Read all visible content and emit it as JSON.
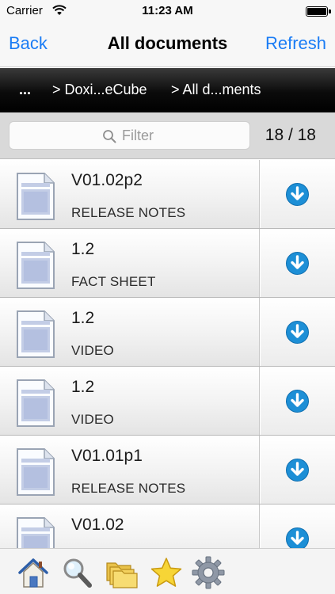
{
  "status_bar": {
    "carrier": "Carrier",
    "time": "11:23 AM",
    "icons": [
      "wifi-icon",
      "battery-icon"
    ]
  },
  "nav": {
    "back_label": "Back",
    "title": "All documents",
    "refresh_label": "Refresh"
  },
  "breadcrumb": {
    "root": "...",
    "items": [
      "> Doxi...eCube",
      "> All d...ments"
    ]
  },
  "filter": {
    "placeholder": "Filter",
    "value": "",
    "count": "18 / 18"
  },
  "documents": [
    {
      "version": "V01.02p2",
      "type": "RELEASE NOTES"
    },
    {
      "version": "1.2",
      "type": "FACT SHEET"
    },
    {
      "version": "1.2",
      "type": "VIDEO"
    },
    {
      "version": "1.2",
      "type": "VIDEO"
    },
    {
      "version": "V01.01p1",
      "type": "RELEASE NOTES"
    },
    {
      "version": "V01.02",
      "type": ""
    }
  ],
  "tab_bar": {
    "tabs": [
      "home-icon",
      "search-icon",
      "folders-icon",
      "favorites-star-icon",
      "settings-gear-icon"
    ]
  },
  "colors": {
    "accent": "#1a7cf5",
    "download": "#1d8fd6",
    "breadcrumb_bg": "#000000"
  }
}
